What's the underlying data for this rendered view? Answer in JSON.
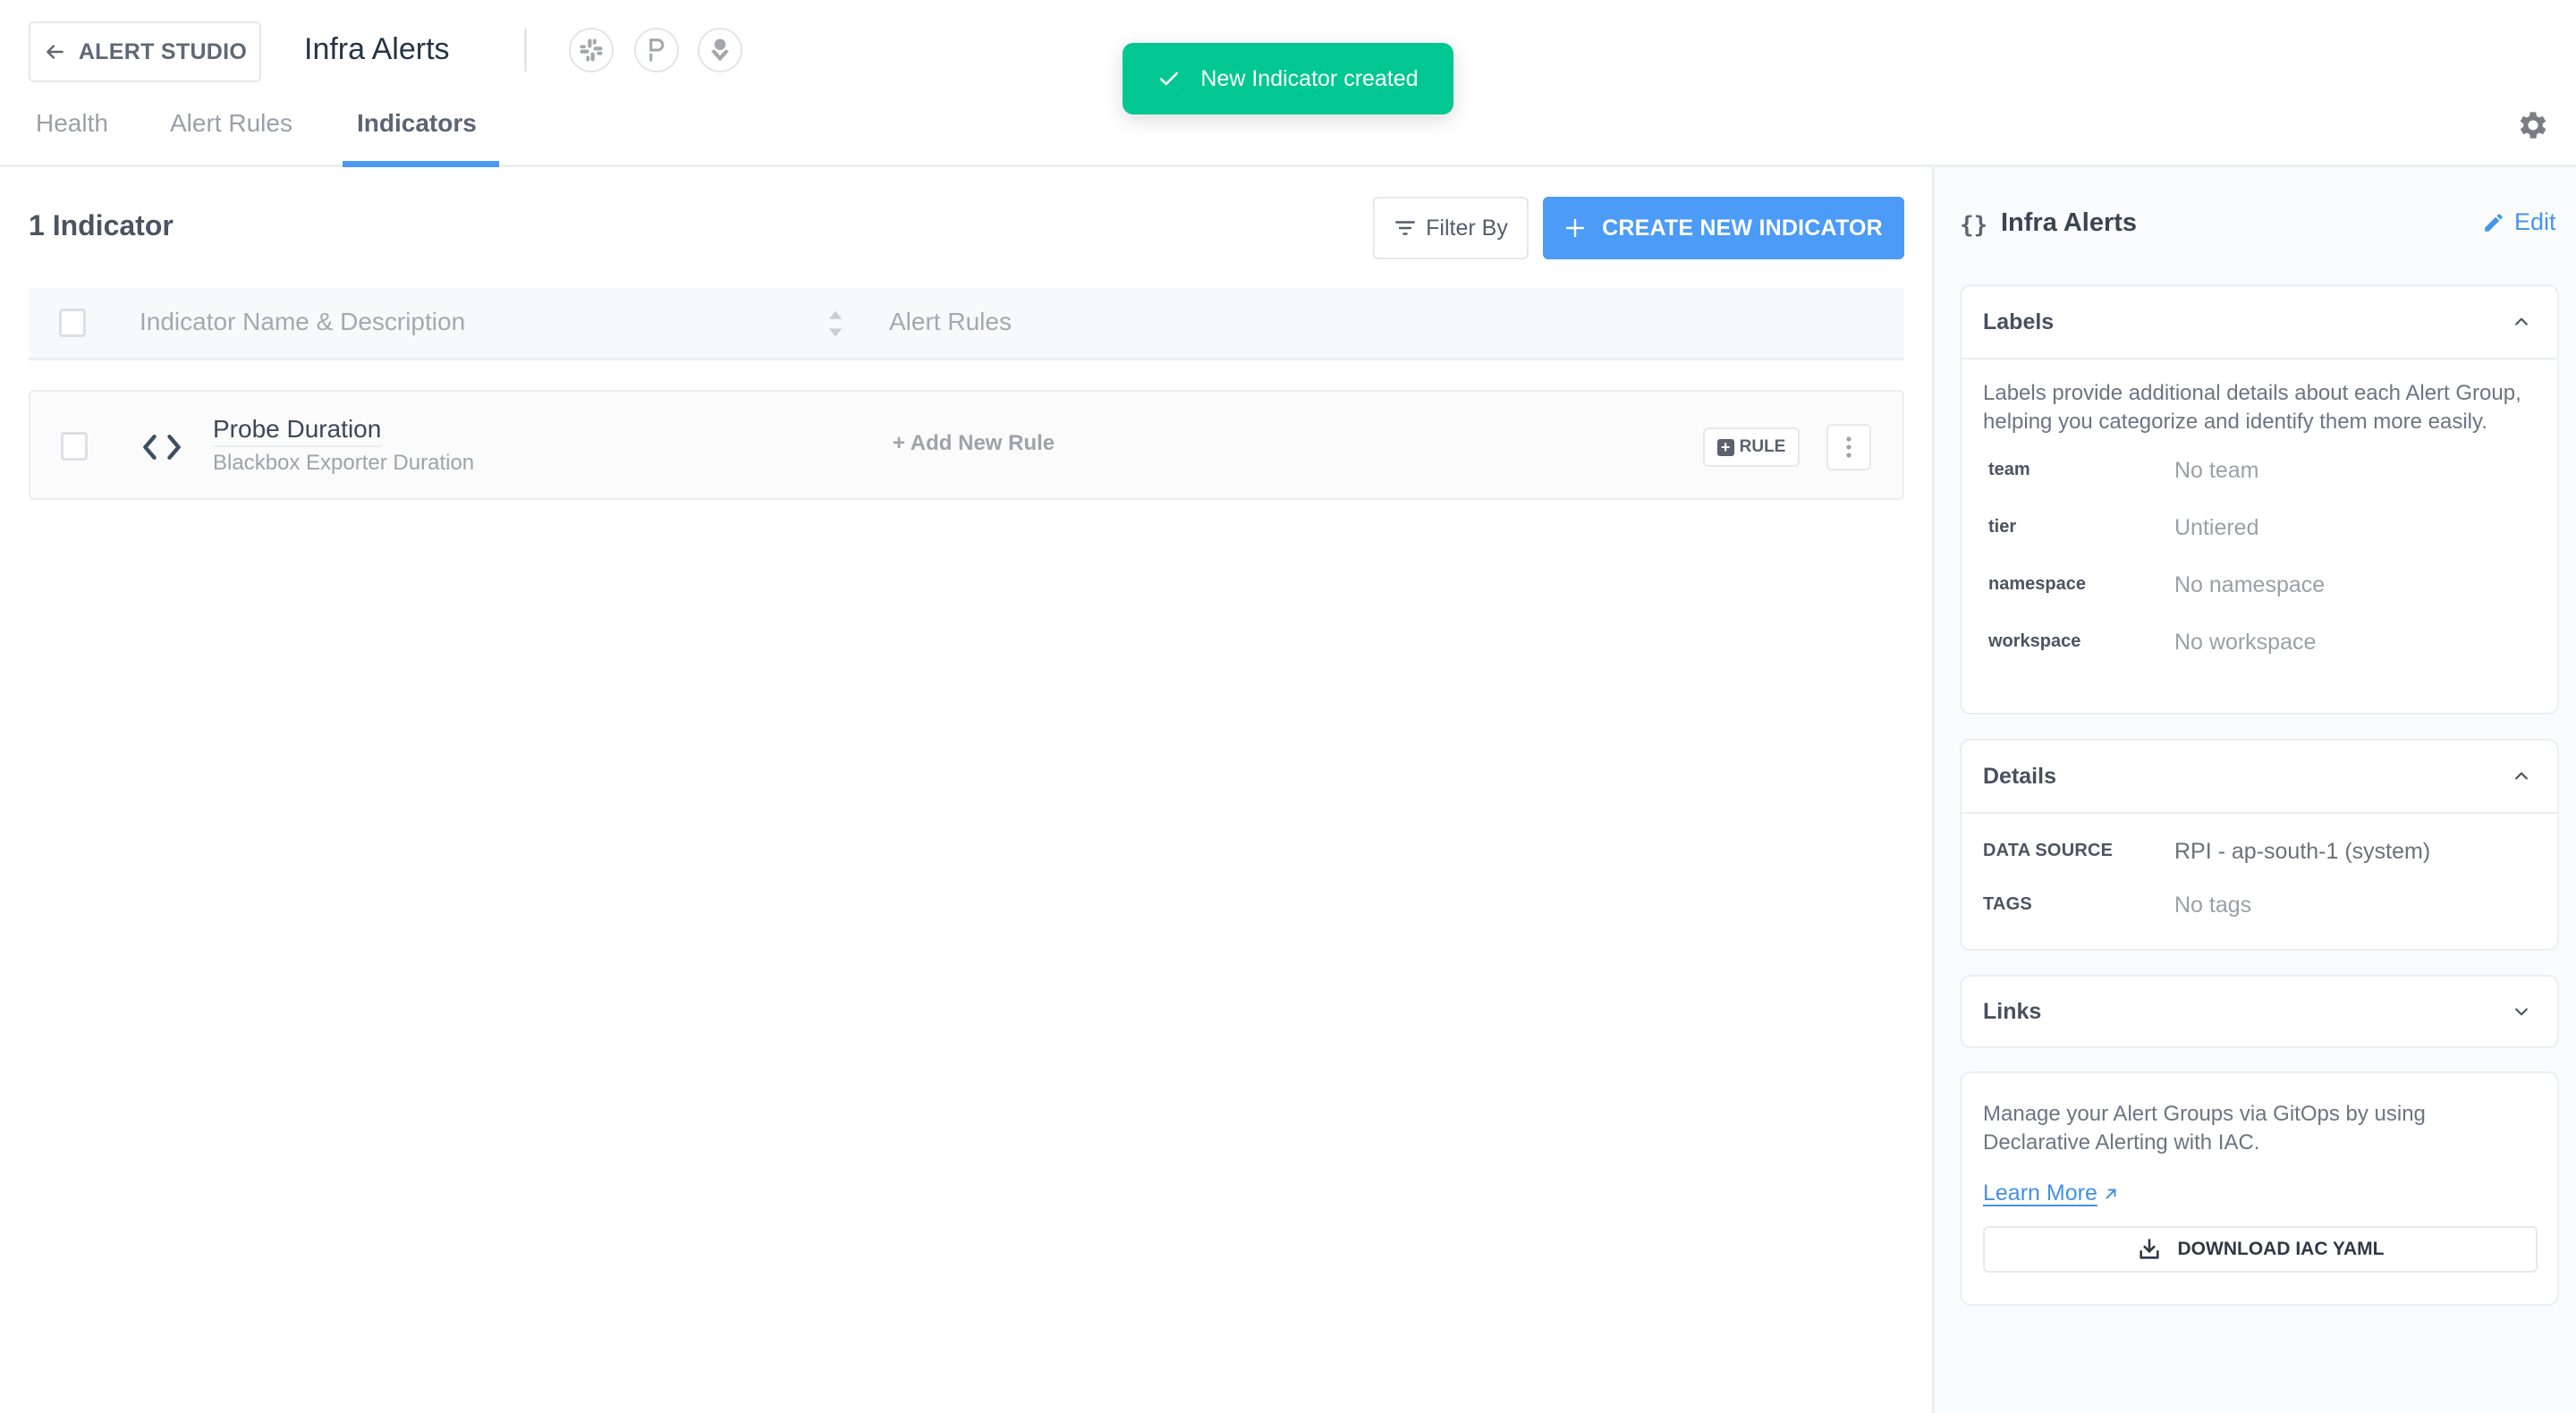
{
  "header": {
    "back_label": "ALERT STUDIO",
    "title": "Infra Alerts",
    "integrations": [
      {
        "name": "slack",
        "icon": "slack-icon"
      },
      {
        "name": "pagerduty",
        "icon": "pagerduty-icon"
      },
      {
        "name": "opsgenie",
        "icon": "opsgenie-icon"
      }
    ],
    "tabs": [
      {
        "label": "Health",
        "active": false
      },
      {
        "label": "Alert Rules",
        "active": false
      },
      {
        "label": "Indicators",
        "active": true
      }
    ],
    "settings_icon": "gear-icon"
  },
  "toast": {
    "message": "New Indicator created",
    "icon": "check-icon",
    "color": "#01c792"
  },
  "main": {
    "count_title": "1 Indicator",
    "filter_label": "Filter By",
    "create_label": "CREATE NEW INDICATOR",
    "accent_color": "#4b9bf7",
    "table": {
      "columns": [
        "Indicator Name & Description",
        "Alert Rules"
      ],
      "rows": [
        {
          "name": "Probe Duration",
          "description": "Blackbox Exporter Duration",
          "add_rule_label": "+ Add New Rule",
          "rule_button_label": "RULE"
        }
      ]
    }
  },
  "sidebar": {
    "title": "Infra Alerts",
    "edit_label": "Edit",
    "labels": {
      "title": "Labels",
      "description": "Labels provide additional details about each Alert Group, helping you categorize and identify them more easily.",
      "items": [
        {
          "key": "team",
          "value": "No team"
        },
        {
          "key": "tier",
          "value": "Untiered"
        },
        {
          "key": "namespace",
          "value": "No namespace"
        },
        {
          "key": "workspace",
          "value": "No workspace"
        }
      ]
    },
    "details": {
      "title": "Details",
      "items": [
        {
          "key": "DATA SOURCE",
          "value": "RPI - ap-south-1 (system)"
        },
        {
          "key": "TAGS",
          "value": "No tags"
        }
      ]
    },
    "links": {
      "title": "Links"
    },
    "gitops": {
      "description": "Manage your Alert Groups via GitOps by using Declarative Alerting with IAC.",
      "learn_more_label": "Learn More",
      "download_label": "DOWNLOAD IAC YAML"
    }
  }
}
